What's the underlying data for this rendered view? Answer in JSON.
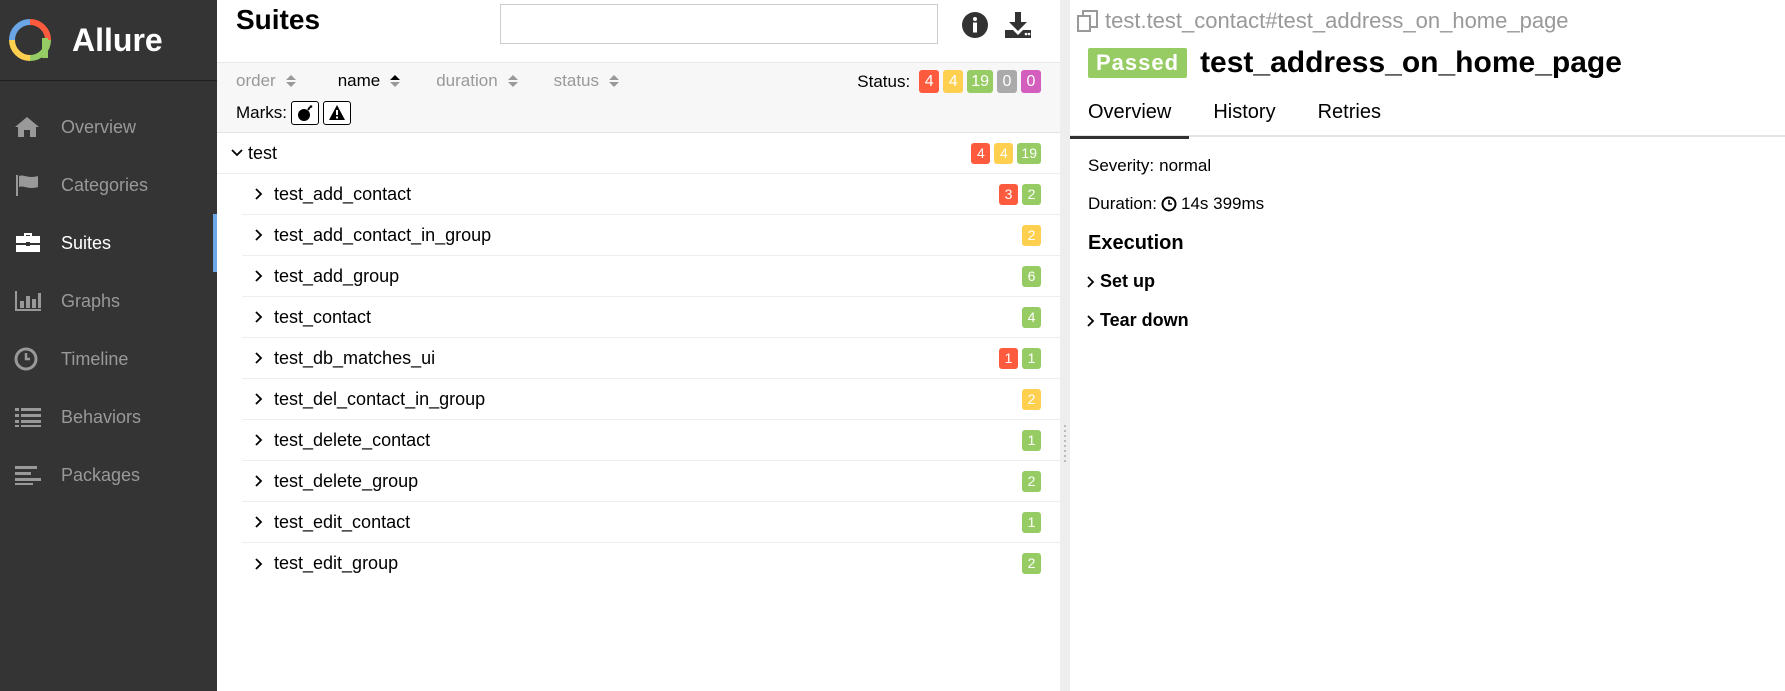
{
  "app": {
    "name": "Allure"
  },
  "sidebar": {
    "items": [
      {
        "label": "Overview",
        "icon": "home-icon",
        "active": false
      },
      {
        "label": "Categories",
        "icon": "flag-icon",
        "active": false
      },
      {
        "label": "Suites",
        "icon": "briefcase-icon",
        "active": true
      },
      {
        "label": "Graphs",
        "icon": "bar-chart-icon",
        "active": false
      },
      {
        "label": "Timeline",
        "icon": "clock-icon",
        "active": false
      },
      {
        "label": "Behaviors",
        "icon": "list-icon",
        "active": false
      },
      {
        "label": "Packages",
        "icon": "align-left-icon",
        "active": false
      }
    ]
  },
  "suites": {
    "title": "Suites",
    "search_value": "",
    "sort": {
      "order_label": "order",
      "name_label": "name",
      "duration_label": "duration",
      "status_label": "status"
    },
    "status_label": "Status:",
    "status_counts": {
      "failed": "4",
      "broken": "4",
      "passed": "19",
      "skipped": "0",
      "unknown": "0"
    },
    "marks_label": "Marks:",
    "group": {
      "name": "test",
      "counts": {
        "failed": "4",
        "broken": "4",
        "passed": "19"
      }
    },
    "rows": [
      {
        "name": "test_add_contact",
        "failed": "3",
        "passed": "2"
      },
      {
        "name": "test_add_contact_in_group",
        "broken": "2"
      },
      {
        "name": "test_add_group",
        "passed": "6"
      },
      {
        "name": "test_contact",
        "passed": "4"
      },
      {
        "name": "test_db_matches_ui",
        "failed": "1",
        "passed": "1"
      },
      {
        "name": "test_del_contact_in_group",
        "broken": "2"
      },
      {
        "name": "test_delete_contact",
        "passed": "1"
      },
      {
        "name": "test_delete_group",
        "passed": "2"
      },
      {
        "name": "test_edit_contact",
        "passed": "1"
      },
      {
        "name": "test_edit_group",
        "passed": "2"
      }
    ]
  },
  "colors": {
    "failed": "#fd5a3e",
    "broken": "#ffd050",
    "passed": "#97cc64",
    "skipped": "#aaaaaa",
    "unknown": "#d35ebe",
    "sidebar_bg": "#343434",
    "accent": "#6ba7e6"
  },
  "testcase": {
    "path": "test.test_contact#test_address_on_home_page",
    "status": "Passed",
    "title": "test_address_on_home_page",
    "tabs": [
      "Overview",
      "History",
      "Retries"
    ],
    "severity_label": "Severity:",
    "severity_value": "normal",
    "duration_label": "Duration:",
    "duration_value": "14s 399ms",
    "execution_title": "Execution",
    "execution_items": [
      "Set up",
      "Tear down"
    ]
  }
}
